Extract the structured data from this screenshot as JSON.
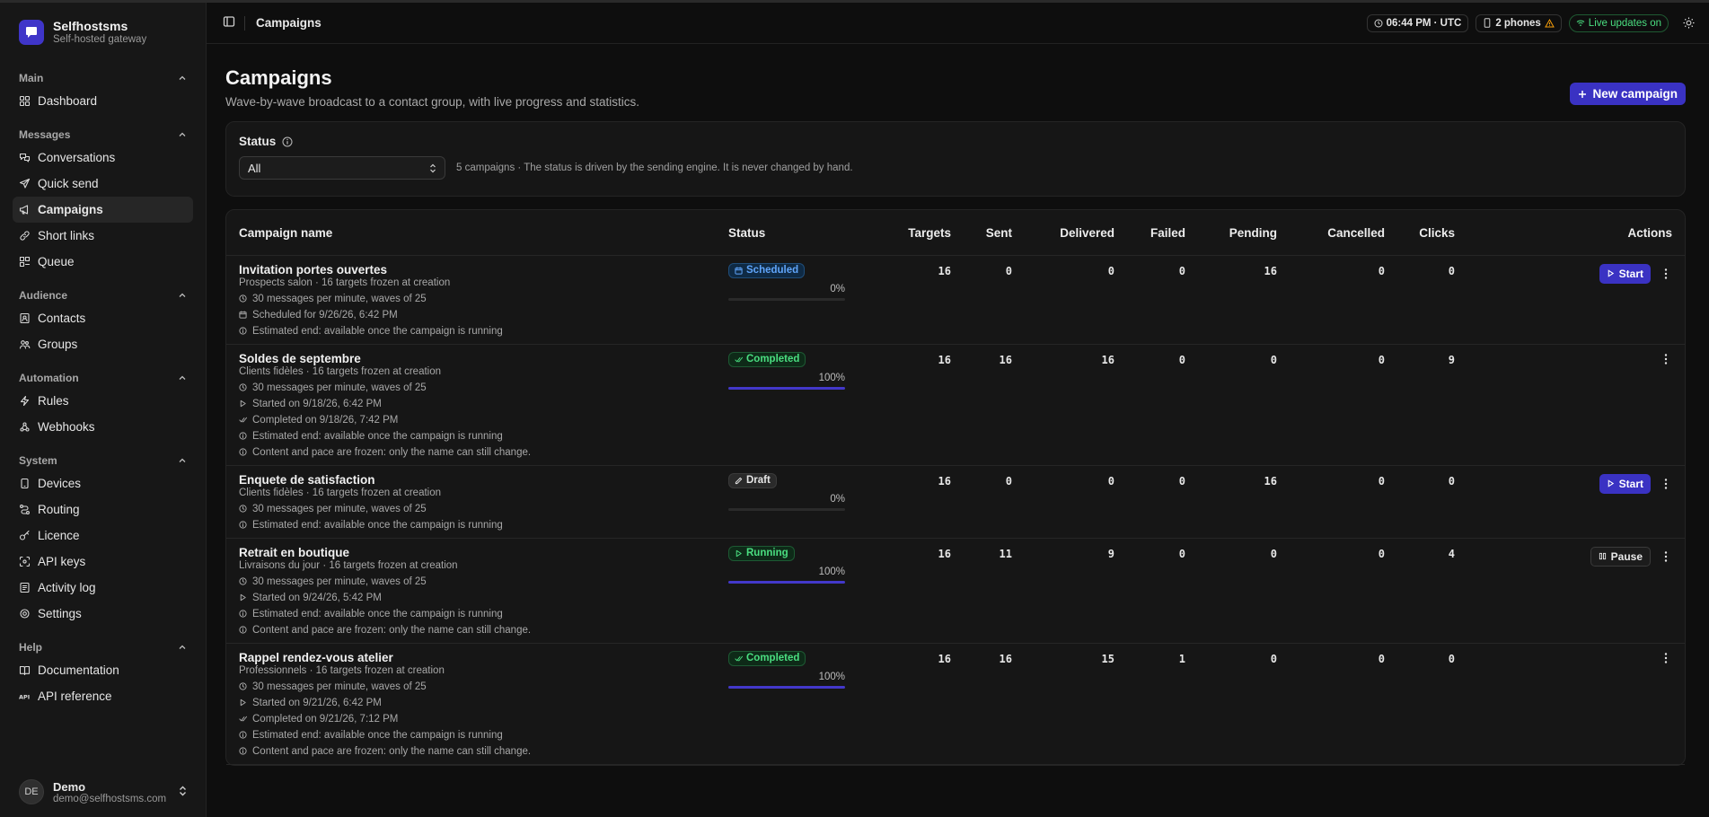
{
  "brand": {
    "title": "Selfhostsms",
    "subtitle": "Self-hosted gateway"
  },
  "sidebar": {
    "sections": [
      {
        "title": "Main",
        "items": [
          {
            "label": "Dashboard",
            "icon": "dashboard-icon"
          }
        ]
      },
      {
        "title": "Messages",
        "items": [
          {
            "label": "Conversations",
            "icon": "conversations-icon"
          },
          {
            "label": "Quick send",
            "icon": "send-icon"
          },
          {
            "label": "Campaigns",
            "icon": "megaphone-icon",
            "active": true
          },
          {
            "label": "Short links",
            "icon": "link-icon"
          },
          {
            "label": "Queue",
            "icon": "queue-icon"
          }
        ]
      },
      {
        "title": "Audience",
        "items": [
          {
            "label": "Contacts",
            "icon": "contacts-icon"
          },
          {
            "label": "Groups",
            "icon": "groups-icon"
          }
        ]
      },
      {
        "title": "Automation",
        "items": [
          {
            "label": "Rules",
            "icon": "bolt-icon"
          },
          {
            "label": "Webhooks",
            "icon": "webhook-icon"
          }
        ]
      },
      {
        "title": "System",
        "items": [
          {
            "label": "Devices",
            "icon": "device-icon"
          },
          {
            "label": "Routing",
            "icon": "routing-icon"
          },
          {
            "label": "Licence",
            "icon": "key-icon"
          },
          {
            "label": "API keys",
            "icon": "api-key-icon"
          },
          {
            "label": "Activity log",
            "icon": "activity-icon"
          },
          {
            "label": "Settings",
            "icon": "gear-icon"
          }
        ]
      },
      {
        "title": "Help",
        "items": [
          {
            "label": "Documentation",
            "icon": "book-icon"
          },
          {
            "label": "API reference",
            "icon": "api-icon"
          }
        ]
      }
    ]
  },
  "user": {
    "initials": "DE",
    "name": "Demo",
    "email": "demo@selfhostsms.com"
  },
  "topbar": {
    "breadcrumb": "Campaigns",
    "time": "06:44 PM · UTC",
    "phones": "2 phones",
    "live": "Live updates on"
  },
  "page": {
    "title": "Campaigns",
    "subtitle": "Wave-by-wave broadcast to a contact group, with live progress and statistics.",
    "new_button": "New campaign"
  },
  "filter": {
    "label": "Status",
    "selected": "All",
    "note": "5 campaigns · The status is driven by the sending engine. It is never changed by hand."
  },
  "table": {
    "headers": {
      "name": "Campaign name",
      "status": "Status",
      "targets": "Targets",
      "sent": "Sent",
      "delivered": "Delivered",
      "failed": "Failed",
      "pending": "Pending",
      "cancelled": "Cancelled",
      "clicks": "Clicks",
      "actions": "Actions"
    },
    "rows": [
      {
        "name": "Invitation portes ouvertes",
        "group": "Prospects salon · 16 targets frozen at creation",
        "details": [
          {
            "icon": "clock-icon",
            "text": "30 messages per minute, waves of 25"
          },
          {
            "icon": "calendar-icon",
            "text": "Scheduled for 9/26/26, 6:42 PM"
          },
          {
            "icon": "info-icon",
            "text": "Estimated end: available once the campaign is running"
          }
        ],
        "status": "Scheduled",
        "status_kind": "scheduled",
        "status_icon": "calendar-icon",
        "progress_label": "0%",
        "progress": 0,
        "targets": "16",
        "sent": "0",
        "delivered": "0",
        "failed": "0",
        "pending": "16",
        "cancelled": "0",
        "clicks": "0",
        "action": "Start",
        "action_kind": "start"
      },
      {
        "name": "Soldes de septembre",
        "group": "Clients fidèles · 16 targets frozen at creation",
        "details": [
          {
            "icon": "clock-icon",
            "text": "30 messages per minute, waves of 25"
          },
          {
            "icon": "play-icon",
            "text": "Started on 9/18/26, 6:42 PM"
          },
          {
            "icon": "check-icon",
            "text": "Completed on 9/18/26, 7:42 PM"
          },
          {
            "icon": "info-icon",
            "text": "Estimated end: available once the campaign is running"
          },
          {
            "icon": "info-icon",
            "text": "Content and pace are frozen: only the name can still change."
          }
        ],
        "status": "Completed",
        "status_kind": "completed",
        "status_icon": "check-icon",
        "progress_label": "100%",
        "progress": 100,
        "targets": "16",
        "sent": "16",
        "delivered": "16",
        "failed": "0",
        "pending": "0",
        "cancelled": "0",
        "clicks": "9",
        "action": "",
        "action_kind": "none"
      },
      {
        "name": "Enquete de satisfaction",
        "group": "Clients fidèles · 16 targets frozen at creation",
        "details": [
          {
            "icon": "clock-icon",
            "text": "30 messages per minute, waves of 25"
          },
          {
            "icon": "info-icon",
            "text": "Estimated end: available once the campaign is running"
          }
        ],
        "status": "Draft",
        "status_kind": "draft",
        "status_icon": "pencil-icon",
        "progress_label": "0%",
        "progress": 0,
        "targets": "16",
        "sent": "0",
        "delivered": "0",
        "failed": "0",
        "pending": "16",
        "cancelled": "0",
        "clicks": "0",
        "action": "Start",
        "action_kind": "start"
      },
      {
        "name": "Retrait en boutique",
        "group": "Livraisons du jour · 16 targets frozen at creation",
        "details": [
          {
            "icon": "clock-icon",
            "text": "30 messages per minute, waves of 25"
          },
          {
            "icon": "play-icon",
            "text": "Started on 9/24/26, 5:42 PM"
          },
          {
            "icon": "info-icon",
            "text": "Estimated end: available once the campaign is running"
          },
          {
            "icon": "info-icon",
            "text": "Content and pace are frozen: only the name can still change."
          }
        ],
        "status": "Running",
        "status_kind": "running",
        "status_icon": "play-icon",
        "progress_label": "100%",
        "progress": 100,
        "targets": "16",
        "sent": "11",
        "delivered": "9",
        "failed": "0",
        "pending": "0",
        "cancelled": "0",
        "clicks": "4",
        "action": "Pause",
        "action_kind": "pause"
      },
      {
        "name": "Rappel rendez-vous atelier",
        "group": "Professionnels · 16 targets frozen at creation",
        "details": [
          {
            "icon": "clock-icon",
            "text": "30 messages per minute, waves of 25"
          },
          {
            "icon": "play-icon",
            "text": "Started on 9/21/26, 6:42 PM"
          },
          {
            "icon": "check-icon",
            "text": "Completed on 9/21/26, 7:12 PM"
          },
          {
            "icon": "info-icon",
            "text": "Estimated end: available once the campaign is running"
          },
          {
            "icon": "info-icon",
            "text": "Content and pace are frozen: only the name can still change."
          }
        ],
        "status": "Completed",
        "status_kind": "completed",
        "status_icon": "check-icon",
        "progress_label": "100%",
        "progress": 100,
        "targets": "16",
        "sent": "16",
        "delivered": "15",
        "failed": "1",
        "pending": "0",
        "cancelled": "0",
        "clicks": "0",
        "action": "",
        "action_kind": "none"
      }
    ]
  }
}
